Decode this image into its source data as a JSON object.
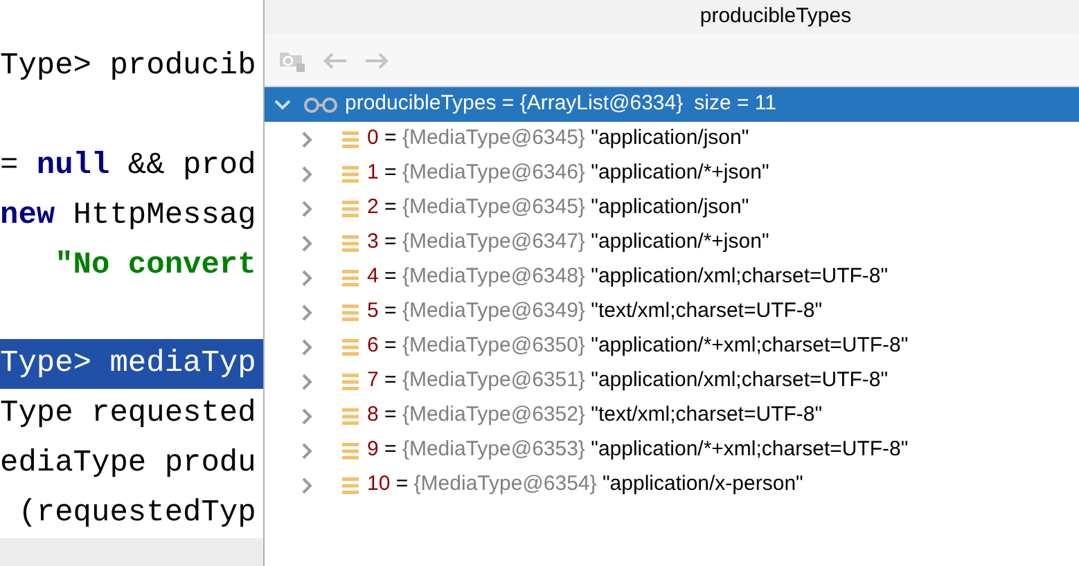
{
  "editor": {
    "lines": [
      {
        "selected": false,
        "segments": [
          {
            "kind": "plain",
            "text": "Type> producib"
          }
        ]
      },
      {
        "selected": false
      },
      {
        "selected": false,
        "segments": [
          {
            "kind": "plain",
            "text": "= "
          },
          {
            "kind": "keyword",
            "text": "null"
          },
          {
            "kind": "plain",
            "text": " && prod"
          }
        ]
      },
      {
        "selected": false,
        "segments": [
          {
            "kind": "keyword",
            "text": "new"
          },
          {
            "kind": "plain",
            "text": " HttpMessag"
          }
        ]
      },
      {
        "selected": false,
        "segments": [
          {
            "kind": "string",
            "text": "   \"No convert"
          }
        ]
      },
      {
        "selected": false
      },
      {
        "selected": true,
        "segments": [
          {
            "kind": "plain",
            "text": "Type> mediaTyp"
          }
        ]
      },
      {
        "selected": false,
        "segments": [
          {
            "kind": "plain",
            "text": "Type requested"
          }
        ]
      },
      {
        "selected": false,
        "segments": [
          {
            "kind": "plain",
            "text": "ediaType produ"
          }
        ]
      },
      {
        "selected": false,
        "segments": [
          {
            "kind": "plain",
            "text": " (requestedTyp"
          }
        ]
      }
    ]
  },
  "popup": {
    "title": "producibleTypes",
    "root": {
      "expanded": true,
      "selected": true,
      "name": "producibleTypes",
      "value": "= {ArrayList@6334}",
      "size": "size = 11",
      "children": [
        {
          "index": "0",
          "sep": "=",
          "type": "{MediaType@6345}",
          "value": "\"application/json\""
        },
        {
          "index": "1",
          "sep": "=",
          "type": "{MediaType@6346}",
          "value": "\"application/*+json\""
        },
        {
          "index": "2",
          "sep": "=",
          "type": "{MediaType@6345}",
          "value": "\"application/json\""
        },
        {
          "index": "3",
          "sep": "=",
          "type": "{MediaType@6347}",
          "value": "\"application/*+json\""
        },
        {
          "index": "4",
          "sep": "=",
          "type": "{MediaType@6348}",
          "value": "\"application/xml;charset=UTF-8\""
        },
        {
          "index": "5",
          "sep": "=",
          "type": "{MediaType@6349}",
          "value": "\"text/xml;charset=UTF-8\""
        },
        {
          "index": "6",
          "sep": "=",
          "type": "{MediaType@6350}",
          "value": "\"application/*+xml;charset=UTF-8\""
        },
        {
          "index": "7",
          "sep": "=",
          "type": "{MediaType@6351}",
          "value": "\"application/xml;charset=UTF-8\""
        },
        {
          "index": "8",
          "sep": "=",
          "type": "{MediaType@6352}",
          "value": "\"text/xml;charset=UTF-8\""
        },
        {
          "index": "9",
          "sep": "=",
          "type": "{MediaType@6353}",
          "value": "\"application/*+xml;charset=UTF-8\""
        },
        {
          "index": "10",
          "sep": "=",
          "type": "{MediaType@6354}",
          "value": "\"application/x-person\""
        }
      ]
    }
  }
}
